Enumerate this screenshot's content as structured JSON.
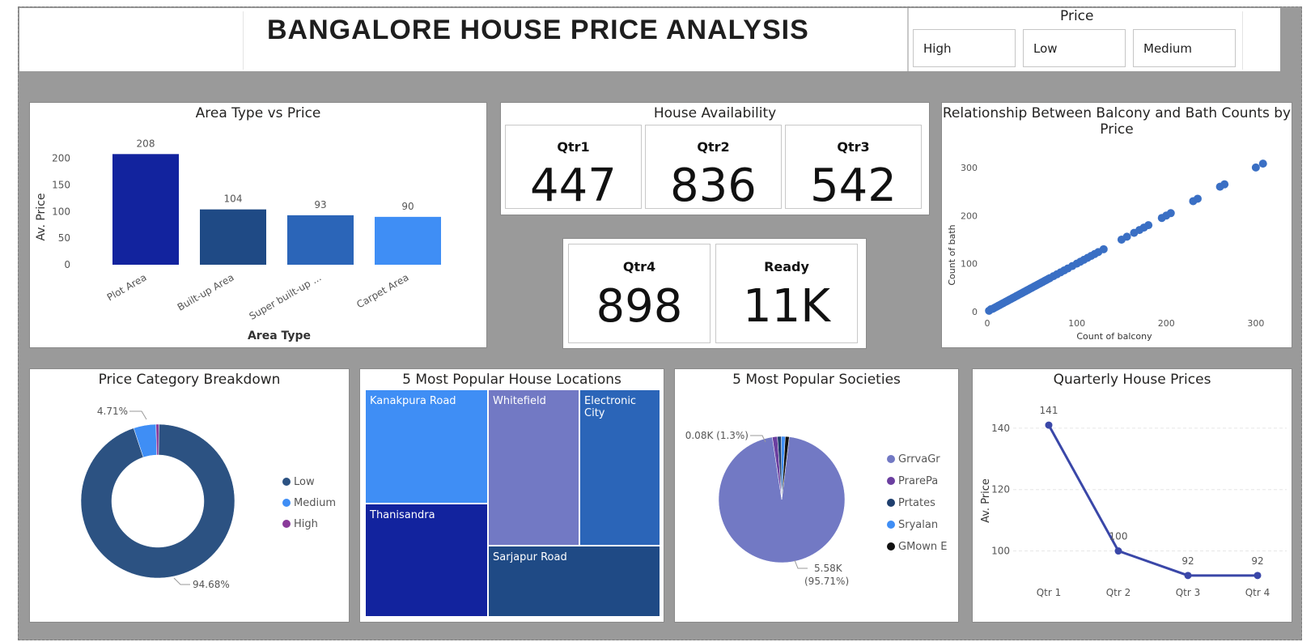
{
  "header": {
    "title": "BANGALORE HOUSE PRICE ANALYSIS",
    "slicer_title": "Price",
    "slicer_options": [
      "High",
      "Low",
      "Medium"
    ]
  },
  "area_chart_title": "Area Type vs Price",
  "availability_title": "House Availability",
  "scatter_title_line1": "Relationship Between Balcony and Bath Counts by",
  "scatter_title_line2": "Price",
  "donut_title": "Price Category Breakdown",
  "treemap_title": "5 Most Popular House Locations",
  "pie_title": "5 Most Popular Societies",
  "line_title": "Quarterly House Prices",
  "kpis": [
    {
      "label": "Qtr1",
      "value": "447"
    },
    {
      "label": "Qtr2",
      "value": "836"
    },
    {
      "label": "Qtr3",
      "value": "542"
    },
    {
      "label": "Qtr4",
      "value": "898"
    },
    {
      "label": "Ready",
      "value": "11K"
    }
  ],
  "colors": {
    "navy": "#12239e",
    "dark_blue": "#1f4a85",
    "mid_blue": "#2b65b8",
    "light_blue": "#3f8ef5",
    "violet": "#7279c4",
    "purple": "#6b3fa0",
    "line": "#3a47a8"
  },
  "chart_data": [
    {
      "type": "bar",
      "title": "Area Type vs Price",
      "xlabel": "Area Type",
      "ylabel": "Av. Price",
      "categories": [
        "Plot Area",
        "Built-up Area",
        "Super built-up ...",
        "Carpet Area"
      ],
      "values": [
        208,
        104,
        93,
        90
      ],
      "data_labels": [
        "208",
        "104",
        "93",
        "90"
      ],
      "colors": [
        "#12239e",
        "#1f4a85",
        "#2b65b8",
        "#3f8ef5"
      ],
      "yticks": [
        "0",
        "50",
        "100",
        "150",
        "200"
      ],
      "ylim": [
        0,
        210
      ]
    },
    {
      "type": "scatter",
      "title": "Relationship Between Balcony and Bath Counts by Price",
      "xlabel": "Count of balcony",
      "ylabel": "Count of bath",
      "xticks": [
        "0",
        "100",
        "200",
        "300"
      ],
      "yticks": [
        "0",
        "100",
        "200",
        "300"
      ],
      "xlim": [
        0,
        320
      ],
      "ylim": [
        0,
        320
      ],
      "points": [
        [
          2,
          2
        ],
        [
          4,
          5
        ],
        [
          6,
          6
        ],
        [
          8,
          8
        ],
        [
          10,
          10
        ],
        [
          12,
          12
        ],
        [
          14,
          14
        ],
        [
          16,
          16
        ],
        [
          18,
          18
        ],
        [
          20,
          20
        ],
        [
          22,
          22
        ],
        [
          24,
          24
        ],
        [
          26,
          26
        ],
        [
          28,
          28
        ],
        [
          30,
          30
        ],
        [
          32,
          32
        ],
        [
          34,
          34
        ],
        [
          36,
          36
        ],
        [
          38,
          38
        ],
        [
          40,
          40
        ],
        [
          42,
          42
        ],
        [
          44,
          44
        ],
        [
          46,
          46
        ],
        [
          48,
          48
        ],
        [
          50,
          50
        ],
        [
          52,
          52
        ],
        [
          54,
          54
        ],
        [
          56,
          56
        ],
        [
          58,
          58
        ],
        [
          60,
          60
        ],
        [
          62,
          62
        ],
        [
          64,
          64
        ],
        [
          66,
          66
        ],
        [
          68,
          68
        ],
        [
          70,
          70
        ],
        [
          74,
          74
        ],
        [
          78,
          78
        ],
        [
          82,
          82
        ],
        [
          86,
          86
        ],
        [
          90,
          90
        ],
        [
          95,
          95
        ],
        [
          100,
          100
        ],
        [
          104,
          104
        ],
        [
          108,
          108
        ],
        [
          112,
          112
        ],
        [
          116,
          116
        ],
        [
          120,
          120
        ],
        [
          124,
          124
        ],
        [
          130,
          130
        ],
        [
          150,
          150
        ],
        [
          156,
          156
        ],
        [
          164,
          164
        ],
        [
          170,
          170
        ],
        [
          175,
          175
        ],
        [
          180,
          180
        ],
        [
          195,
          195
        ],
        [
          200,
          200
        ],
        [
          205,
          205
        ],
        [
          230,
          230
        ],
        [
          235,
          235
        ],
        [
          260,
          260
        ],
        [
          265,
          265
        ],
        [
          300,
          300
        ],
        [
          308,
          308
        ]
      ]
    },
    {
      "type": "pie",
      "title": "Price Category Breakdown",
      "donut": true,
      "labels": [
        "Low",
        "Medium",
        "High"
      ],
      "values": [
        94.68,
        4.71,
        0.61
      ],
      "data_labels": [
        "94.68%",
        "4.71%"
      ],
      "colors": [
        "#2c5282",
        "#3f8ef5",
        "#8a3a9a"
      ]
    },
    {
      "type": "heatmap",
      "title": "5 Most Popular House Locations",
      "labels": [
        "Kanakpura Road",
        "Whitefield",
        "Electronic City",
        "Thanisandra",
        "Sarjapur Road"
      ]
    },
    {
      "type": "pie",
      "title": "5 Most Popular Societies",
      "labels": [
        "GrrvaGr",
        "PrarePa",
        "Prtates",
        "Sryalan",
        "GMown E"
      ],
      "values": [
        95.71,
        1.3,
        1.0,
        1.0,
        1.0
      ],
      "data_labels": [
        "0.08K (1.3%)",
        "5.58K",
        "(95.71%)"
      ],
      "colors": [
        "#7279c4",
        "#6b3fa0",
        "#1f3f6e",
        "#3f8ef5",
        "#111111"
      ]
    },
    {
      "type": "line",
      "title": "Quarterly House Prices",
      "ylabel": "Av. Price",
      "categories": [
        "Qtr 1",
        "Qtr 2",
        "Qtr 3",
        "Qtr 4"
      ],
      "values": [
        141,
        100,
        92,
        92
      ],
      "data_labels": [
        "141",
        "100",
        "92",
        "92"
      ],
      "yticks": [
        "100",
        "120",
        "140"
      ],
      "ylim": [
        88,
        150
      ]
    }
  ]
}
